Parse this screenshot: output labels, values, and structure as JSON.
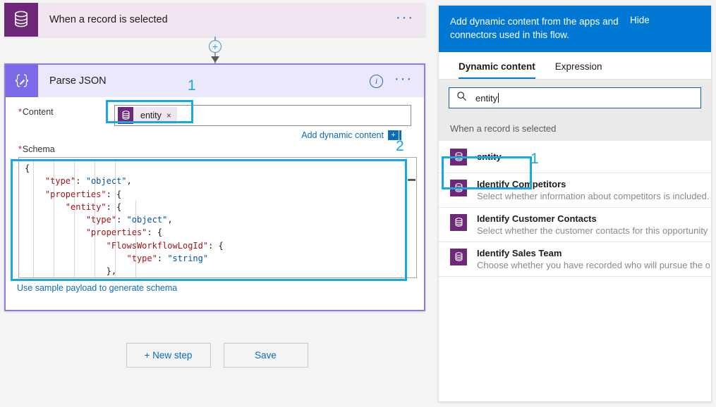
{
  "trigger": {
    "title": "When a record is selected",
    "icon": "database-icon",
    "menu_label": "···"
  },
  "connector": {
    "add_label": "+"
  },
  "parse_json": {
    "title": "Parse JSON",
    "icon": "parse-json-braces-icon",
    "info_label": "i",
    "menu_label": "···",
    "content_label": "Content",
    "schema_label": "Schema",
    "required_star": "*",
    "token": {
      "label": "entity",
      "remove_label": "×",
      "icon": "database-icon"
    },
    "add_dynamic_content": "Add dynamic content",
    "add_dynamic_content_plus": "+",
    "sample_payload_link": "Use sample payload to generate schema",
    "schema_code_lines": [
      "{",
      "    \"type\": \"object\",",
      "    \"properties\": {",
      "        \"entity\": {",
      "            \"type\": \"object\",",
      "            \"properties\": {",
      "                \"FlowsWorkflowLogId\": {",
      "                    \"type\": \"string\"",
      "                },"
    ]
  },
  "buttons": {
    "new_step": "+ New step",
    "save": "Save"
  },
  "annotations": {
    "one": "1",
    "two": "2",
    "one_panel": "1"
  },
  "dynamic_panel": {
    "header_text": "Add dynamic content from the apps and connectors used in this flow.",
    "hide_label": "Hide",
    "tabs": [
      {
        "label": "Dynamic content",
        "active": true
      },
      {
        "label": "Expression",
        "active": false
      }
    ],
    "search": {
      "value": "entity",
      "icon": "search-icon"
    },
    "group_header": "When a record is selected",
    "items": [
      {
        "title": "entity",
        "desc": "",
        "icon": "database-icon",
        "highlighted": true
      },
      {
        "title": "Identify Competitors",
        "desc": "Select whether information about competitors is included.",
        "icon": "database-icon",
        "highlighted": false
      },
      {
        "title": "Identify Customer Contacts",
        "desc": "Select whether the customer contacts for this opportunity ha...",
        "icon": "database-icon",
        "highlighted": false
      },
      {
        "title": "Identify Sales Team",
        "desc": "Choose whether you have recorded who will pursue the opp...",
        "icon": "database-icon",
        "highlighted": false
      }
    ]
  },
  "colors": {
    "accent_blue": "#0078d4",
    "highlight_cyan": "#17a8e0",
    "purple_card": "#7a6ae8",
    "connector_purple": "#6d2878"
  }
}
